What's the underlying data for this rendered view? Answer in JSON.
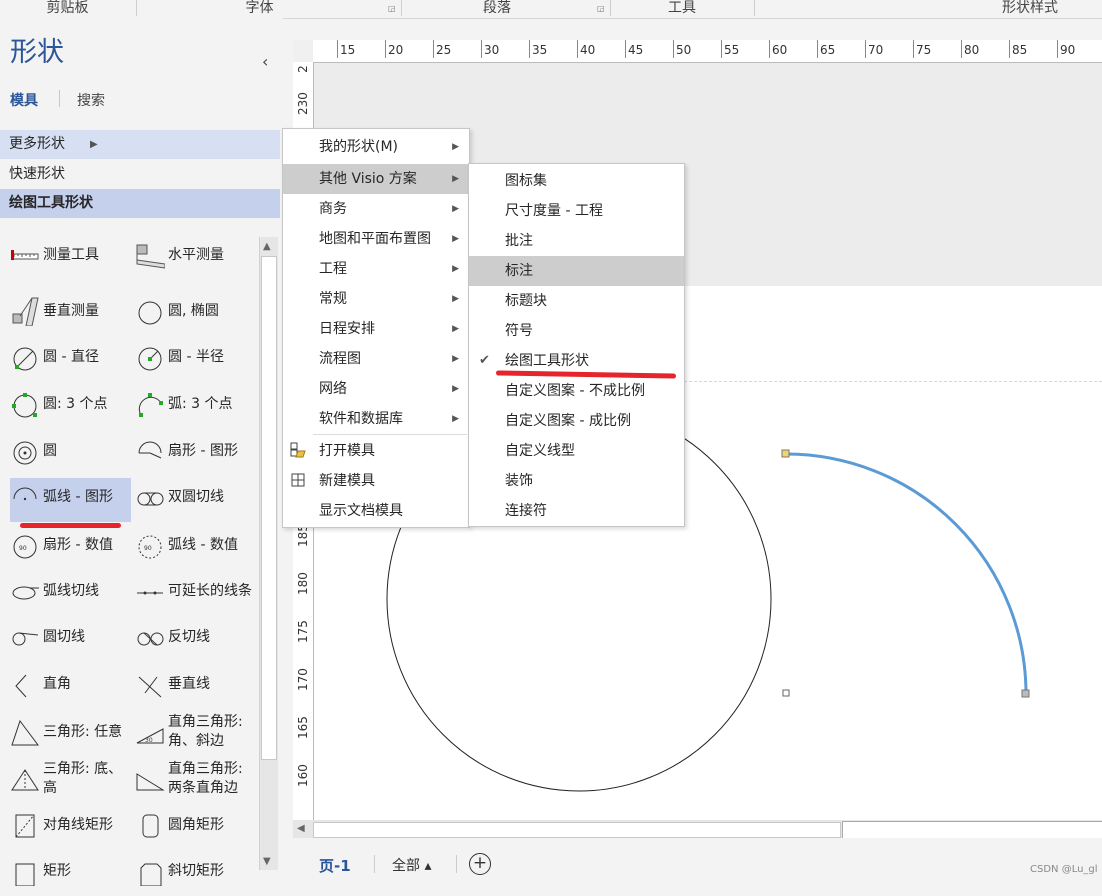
{
  "ribbon": {
    "groups": [
      "剪贴板",
      "字体",
      "段落",
      "工具",
      "形状样式"
    ]
  },
  "pane": {
    "title": "形状",
    "collapse_icon": "chevron-left",
    "tabs": {
      "stencils": "模具",
      "search": "搜索"
    },
    "rows": {
      "more": "更多形状",
      "quick": "快速形状",
      "drawing": "绘图工具形状"
    },
    "shapes": [
      "测量工具",
      "水平测量",
      "垂直测量",
      "圆, 椭圆",
      "圆 - 直径",
      "圆 - 半径",
      "圆: 3 个点",
      "弧: 3 个点",
      "圆",
      "扇形 - 图形",
      "弧线 - 图形",
      "双圆切线",
      "扇形 - 数值",
      "弧线 - 数值",
      "弧线切线",
      "可延长的线条",
      "圆切线",
      "反切线",
      "直角",
      "垂直线",
      "三角形: 任意",
      "直角三角形: 角、斜边",
      "三角形: 底、高",
      "直角三角形: 两条直角边",
      "对角线矩形",
      "圆角矩形",
      "矩形",
      "斜切矩形"
    ],
    "selected_shape": "弧线 - 图形"
  },
  "ruler": {
    "h_ticks": [
      "15",
      "20",
      "25",
      "30",
      "35",
      "40",
      "45",
      "50",
      "55",
      "60",
      "65",
      "70",
      "75",
      "80",
      "85",
      "90"
    ],
    "v_ticks": [
      "2",
      "230",
      "185",
      "180",
      "175",
      "170",
      "165",
      "160"
    ]
  },
  "menu1": {
    "items": [
      {
        "label": "我的形状(M)",
        "submenu": true
      },
      {
        "label": "其他 Visio 方案",
        "submenu": true,
        "highlight": true
      },
      {
        "label": "商务",
        "submenu": true
      },
      {
        "label": "地图和平面布置图",
        "submenu": true
      },
      {
        "label": "工程",
        "submenu": true
      },
      {
        "label": "常规",
        "submenu": true
      },
      {
        "label": "日程安排",
        "submenu": true
      },
      {
        "label": "流程图",
        "submenu": true
      },
      {
        "label": "网络",
        "submenu": true
      },
      {
        "label": "软件和数据库",
        "submenu": true
      }
    ],
    "actions": [
      {
        "label": "打开模具",
        "icon": "open-stencil-icon"
      },
      {
        "label": "新建模具",
        "icon": "new-stencil-icon"
      },
      {
        "label": "显示文档模具",
        "icon": ""
      }
    ]
  },
  "menu2": {
    "items": [
      {
        "label": "图标集"
      },
      {
        "label": "尺寸度量 - 工程"
      },
      {
        "label": "批注"
      },
      {
        "label": "标注",
        "highlight": true
      },
      {
        "label": "标题块"
      },
      {
        "label": "符号"
      },
      {
        "label": "绘图工具形状",
        "checked": true
      },
      {
        "label": "自定义图案 - 不成比例"
      },
      {
        "label": "自定义图案 - 成比例"
      },
      {
        "label": "自定义线型"
      },
      {
        "label": "装饰"
      },
      {
        "label": "连接符"
      }
    ]
  },
  "page_tabs": {
    "page1": "页-1",
    "all": "全部 ▴",
    "add": "+"
  },
  "watermark": "CSDN @Lu_gl",
  "colors": {
    "accent": "#2b579a",
    "arc": "#5b9bd5",
    "annotation": "#e5242b",
    "menu_highlight": "#cdcdcd"
  }
}
